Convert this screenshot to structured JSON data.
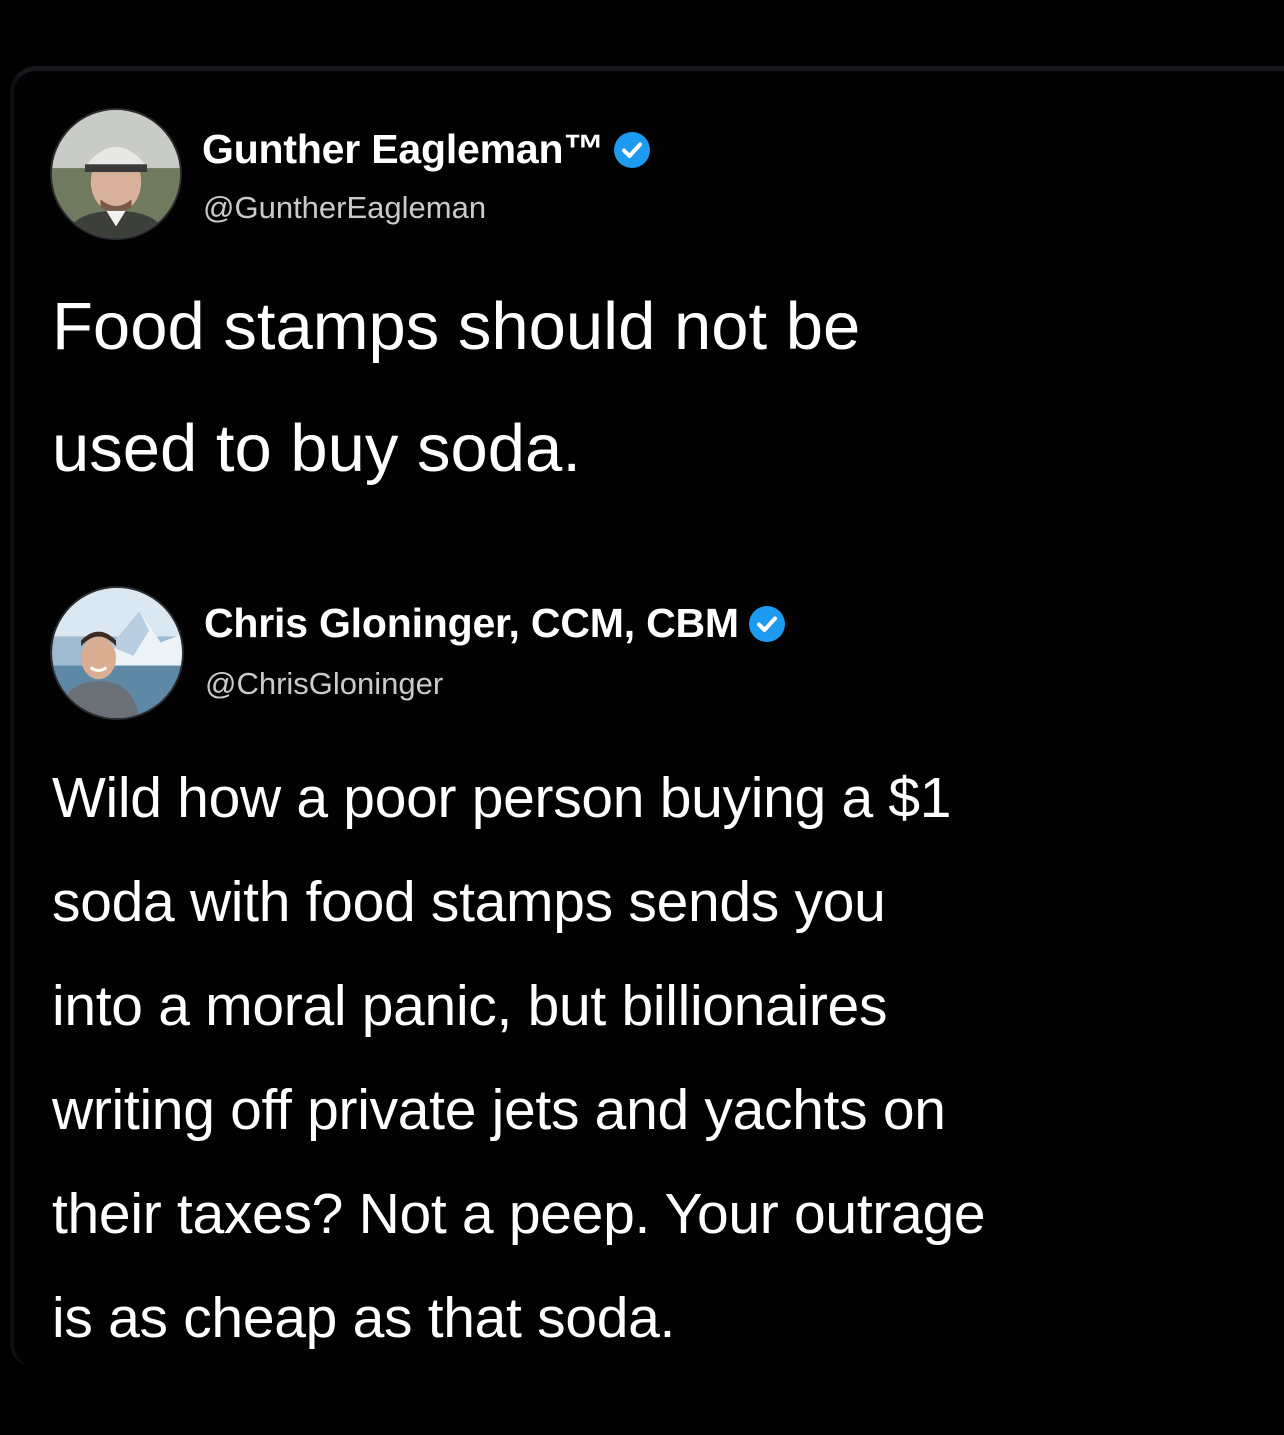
{
  "tweets": [
    {
      "display_name": "Gunther Eagleman™",
      "handle": "@GuntherEagleman",
      "verified": true,
      "avatar_icon": "user-avatar-cap",
      "text": "Food stamps should not be\nused to buy soda."
    },
    {
      "display_name": "Chris Gloninger, CCM, CBM",
      "handle": "@ChrisGloninger",
      "verified": true,
      "avatar_icon": "user-avatar-outdoor",
      "text": "Wild how a poor person buying a $1\nsoda with food stamps sends you\ninto a moral panic, but billionaires\nwriting off private jets and yachts on\ntheir taxes? Not a peep. Your outrage\nis as cheap as that soda."
    }
  ],
  "colors": {
    "background": "#000000",
    "text": "#ffffff",
    "handle": "#c8cacc",
    "verified_badge": "#1d9bf0"
  }
}
